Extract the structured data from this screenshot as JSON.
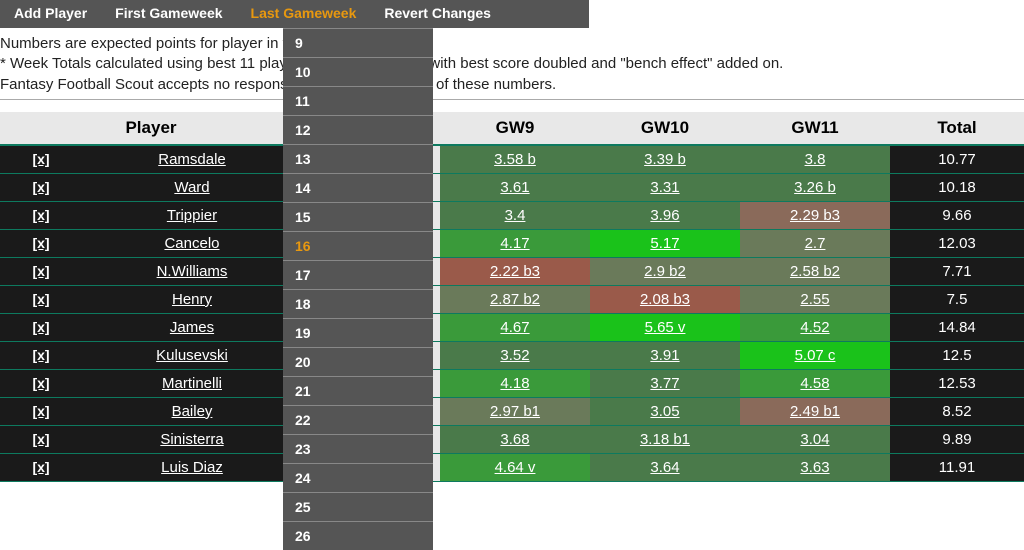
{
  "toolbar": {
    "add_player": "Add Player",
    "first_gw": "First Gameweek",
    "last_gw": "Last Gameweek",
    "revert": "Revert Changes"
  },
  "dropdown": {
    "options": [
      "9",
      "10",
      "11",
      "12",
      "13",
      "14",
      "15",
      "16",
      "17",
      "18",
      "19",
      "20",
      "21",
      "22",
      "23",
      "24",
      "25",
      "26"
    ],
    "selected": "16"
  },
  "notes": {
    "line1": "Numbers are expected points for player in that gameweek.",
    "line2": "* Week Totals calculated using best 11 players in valid formation with best score doubled and \"bench effect\" added on.",
    "line3": "Fantasy Football Scout accepts no responsibility for the accuracy of these numbers."
  },
  "columns": {
    "player": "Player",
    "gw9": "GW9",
    "gw10": "GW10",
    "gw11": "GW11",
    "total": "Total"
  },
  "delete_label": "[x]",
  "rows": [
    {
      "name": "Ramsdale",
      "gw9": {
        "v": "3.58 b",
        "c": "g-dark"
      },
      "gw10": {
        "v": "3.39 b",
        "c": "g-dark"
      },
      "gw11": {
        "v": "3.8",
        "c": "g-dark"
      },
      "total": "10.77"
    },
    {
      "name": "Ward",
      "gw9": {
        "v": "3.61",
        "c": "g-dark"
      },
      "gw10": {
        "v": "3.31",
        "c": "g-dark"
      },
      "gw11": {
        "v": "3.26 b",
        "c": "g-dark"
      },
      "total": "10.18"
    },
    {
      "name": "Trippier",
      "gw9": {
        "v": "3.4",
        "c": "g-dark"
      },
      "gw10": {
        "v": "3.96",
        "c": "g-dark"
      },
      "gw11": {
        "v": "2.29 b3",
        "c": "r-dull"
      },
      "total": "9.66"
    },
    {
      "name": "Cancelo",
      "gw9": {
        "v": "4.17",
        "c": "g-med"
      },
      "gw10": {
        "v": "5.17",
        "c": "g-bright"
      },
      "gw11": {
        "v": "2.7",
        "c": "g-dull"
      },
      "total": "12.03"
    },
    {
      "name": "N.Williams",
      "gw9": {
        "v": "2.22 b3",
        "c": "r-med"
      },
      "gw10": {
        "v": "2.9 b2",
        "c": "g-dull"
      },
      "gw11": {
        "v": "2.58 b2",
        "c": "g-dull"
      },
      "total": "7.71"
    },
    {
      "name": "Henry",
      "gw9": {
        "v": "2.87 b2",
        "c": "g-dull"
      },
      "gw10": {
        "v": "2.08 b3",
        "c": "r-med"
      },
      "gw11": {
        "v": "2.55",
        "c": "g-dull"
      },
      "total": "7.5"
    },
    {
      "name": "James",
      "gw9": {
        "v": "4.67",
        "c": "g-med"
      },
      "gw10": {
        "v": "5.65 v",
        "c": "g-bright"
      },
      "gw11": {
        "v": "4.52",
        "c": "g-med"
      },
      "total": "14.84"
    },
    {
      "name": "Kulusevski",
      "gw9": {
        "v": "3.52",
        "c": "g-dark"
      },
      "gw10": {
        "v": "3.91",
        "c": "g-dark"
      },
      "gw11": {
        "v": "5.07 c",
        "c": "g-bright"
      },
      "total": "12.5"
    },
    {
      "name": "Martinelli",
      "gw9": {
        "v": "4.18",
        "c": "g-med"
      },
      "gw10": {
        "v": "3.77",
        "c": "g-dark"
      },
      "gw11": {
        "v": "4.58",
        "c": "g-med"
      },
      "total": "12.53"
    },
    {
      "name": "Bailey",
      "gw9": {
        "v": "2.97 b1",
        "c": "g-dull"
      },
      "gw10": {
        "v": "3.05",
        "c": "g-dark"
      },
      "gw11": {
        "v": "2.49 b1",
        "c": "r-dull"
      },
      "total": "8.52"
    },
    {
      "name": "Sinisterra",
      "gw9": {
        "v": "3.68",
        "c": "g-dark"
      },
      "gw10": {
        "v": "3.18 b1",
        "c": "g-dark"
      },
      "gw11": {
        "v": "3.04",
        "c": "g-dark"
      },
      "total": "9.89"
    },
    {
      "name": "Luis Diaz",
      "gw9": {
        "v": "4.64 v",
        "c": "g-med"
      },
      "gw10": {
        "v": "3.64",
        "c": "g-dark"
      },
      "gw11": {
        "v": "3.63",
        "c": "g-dark"
      },
      "total": "11.91"
    }
  ]
}
